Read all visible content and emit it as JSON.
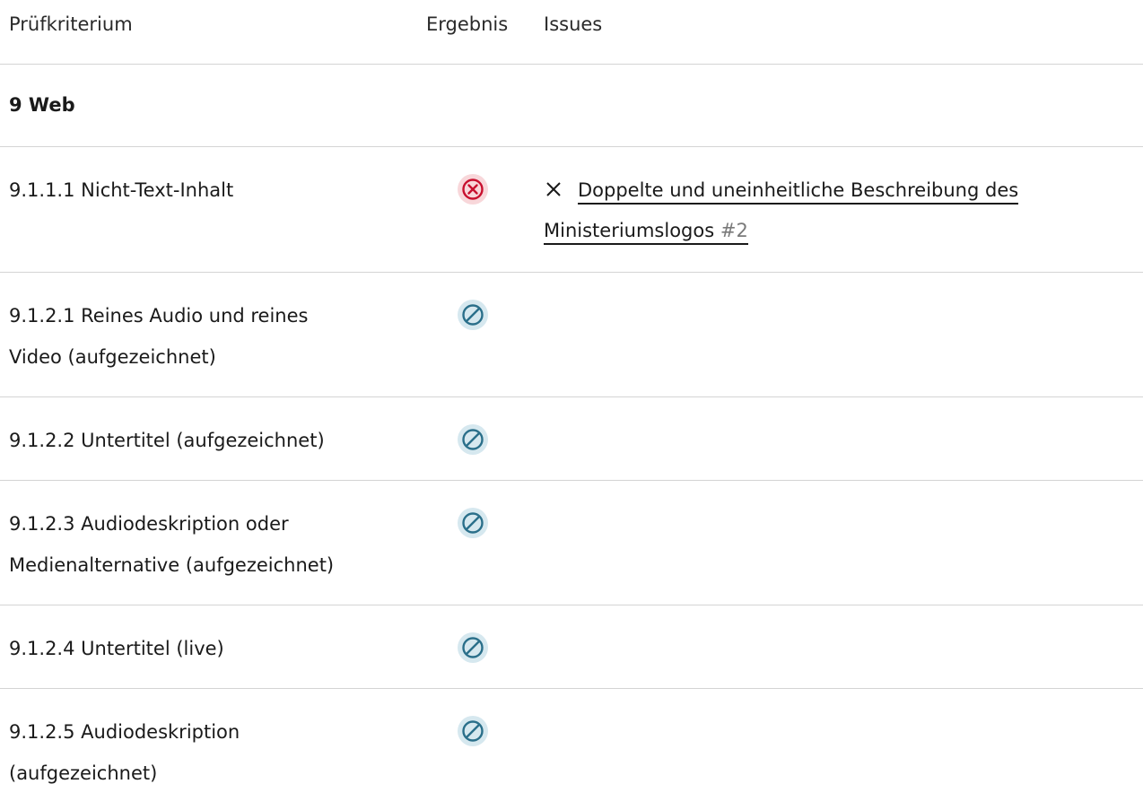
{
  "table": {
    "headers": {
      "criterion": "Prüfkriterium",
      "result": "Ergebnis",
      "issues": "Issues"
    },
    "section": {
      "title": "9 Web"
    },
    "rows": [
      {
        "criterion": "9.1.1.1 Nicht-Text-Inhalt",
        "result": "failed",
        "result_icon": "failed-icon",
        "issue": {
          "prefix_icon": "close-icon",
          "line1": "Doppelte und uneinheitliche Beschreibung des",
          "line2": "Ministeriumslogos",
          "number": "#2"
        }
      },
      {
        "criterion_line1": "9.1.2.1 Reines Audio und reines",
        "criterion_line2": "Video (aufgezeichnet)",
        "result": "not-applicable",
        "result_icon": "not-applicable-icon"
      },
      {
        "criterion": "9.1.2.2 Untertitel (aufgezeichnet)",
        "result": "not-applicable",
        "result_icon": "not-applicable-icon"
      },
      {
        "criterion_line1": "9.1.2.3 Audiodeskription oder",
        "criterion_line2": "Medienalternative (aufgezeichnet)",
        "result": "not-applicable",
        "result_icon": "not-applicable-icon"
      },
      {
        "criterion": "9.1.2.4 Untertitel (live)",
        "result": "not-applicable",
        "result_icon": "not-applicable-icon"
      },
      {
        "criterion_line1": "9.1.2.5 Audiodeskription",
        "criterion_line2": "(aufgezeichnet)",
        "result": "not-applicable",
        "result_icon": "not-applicable-icon"
      }
    ]
  },
  "colors": {
    "failed": "#c8102e",
    "failed_bg": "#f8d7da",
    "not_applicable": "#2a6f8a",
    "not_applicable_bg": "#d6e8ef",
    "divider": "#d4d4d4",
    "issue_number": "#7a7a7a"
  }
}
